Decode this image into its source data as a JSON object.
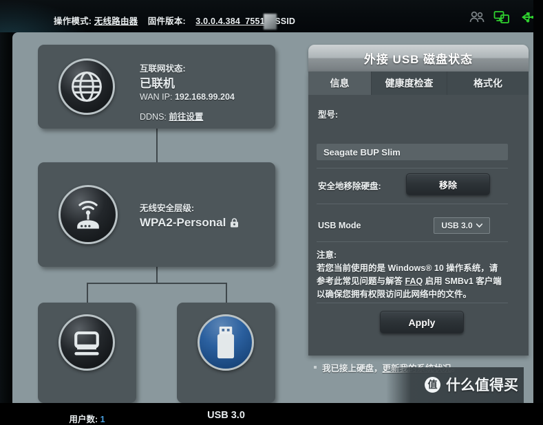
{
  "topbar": {
    "mode_label": "操作模式:",
    "mode_value": "无线路由器",
    "firmware_label": "固件版本:",
    "firmware_value": "3.0.0.4.384_7551",
    "ssid_label": "SSID",
    "icons": [
      "users-icon",
      "network-client-icon",
      "usb-icon"
    ],
    "icon_active_color": "#2fd12f",
    "icon_inactive_color": "#6e7578"
  },
  "network_map": {
    "internet": {
      "icon": "globe-icon",
      "label": "互联网状态:",
      "status": "已联机",
      "wan_ip_label": "WAN IP:",
      "wan_ip_value": "192.168.99.204",
      "ddns_label": "DDNS:",
      "ddns_link": "前往设置"
    },
    "wireless": {
      "icon": "router-wifi-icon",
      "label": "无线安全层级:",
      "value": "WPA2-Personal",
      "lock_icon": "lock-icon"
    },
    "clients": {
      "icon": "monitor-icon",
      "caption_label": "用户数:",
      "caption_value": "1",
      "accent_color": "#49a0e0"
    },
    "usb": {
      "icon": "usb-drive-icon",
      "caption": "USB 3.0"
    }
  },
  "usb_panel": {
    "title": "外接 USB 磁盘状态",
    "tabs": [
      {
        "label": "信息",
        "active": true
      },
      {
        "label": "健康度检查",
        "active": false
      },
      {
        "label": "格式化",
        "active": false
      }
    ],
    "model_label": "型号:",
    "model_value": "Seagate BUP Slim",
    "eject_label": "安全地移除硬盘:",
    "eject_button": "移除",
    "usb_mode_label": "USB Mode",
    "usb_mode_value": "USB 3.0",
    "note_title": "注意:",
    "note_line1": "若您当前使用的是 Windows® 10 操作系统，请",
    "note_line2_a": "参考此常见问题与解答 ",
    "note_link": "FAQ",
    "note_line2_b": " 启用 SMBv1 客户端",
    "note_line3": "以确保您拥有权限访问此网络中的文件。",
    "apply_button": "Apply",
    "footer_text_a": "我已接上硬盘，",
    "footer_link": "更新我的系统状况",
    "footer_text_b": "。"
  },
  "watermark": {
    "badge": "值",
    "text": "什么值得买"
  }
}
